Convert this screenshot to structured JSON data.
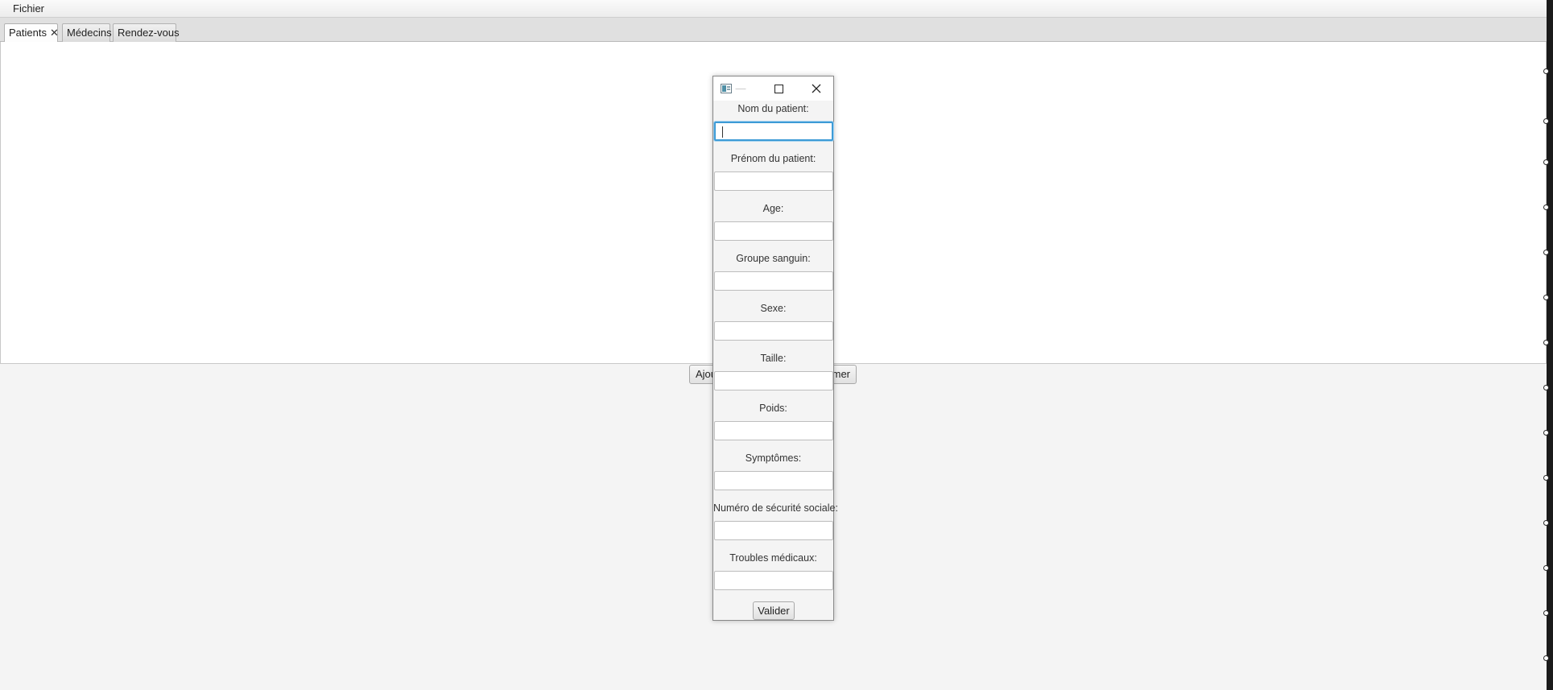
{
  "menubar": {
    "file_label": "Fichier"
  },
  "tabs": {
    "patients": "Patients",
    "patients_close": "✕",
    "medecins": "Médecins",
    "rendezvous": "Rendez-vous"
  },
  "buttons": {
    "ajouter": "Ajou",
    "supprimer": "mer"
  },
  "dialog": {
    "minimize_glyph": "—",
    "fields": {
      "nom": {
        "label": "Nom du patient:",
        "value": ""
      },
      "prenom": {
        "label": "Prénom du patient:",
        "value": ""
      },
      "age": {
        "label": "Age:",
        "value": ""
      },
      "groupe": {
        "label": "Groupe sanguin:",
        "value": ""
      },
      "sexe": {
        "label": "Sexe:",
        "value": ""
      },
      "taille": {
        "label": "Taille:",
        "value": ""
      },
      "poids": {
        "label": "Poids:",
        "value": ""
      },
      "symptomes": {
        "label": "Symptômes:",
        "value": ""
      },
      "secu": {
        "label": "Numéro de sécurité sociale:",
        "value": ""
      },
      "troubles": {
        "label": "Troubles médicaux:",
        "value": ""
      }
    },
    "submit_label": "Valider"
  },
  "colors": {
    "focus": "#3d9bd6",
    "window_bg": "#f4f4f4",
    "content_bg": "#ffffff"
  },
  "icons": {
    "dialog_app": "app-window-icon",
    "maximize": "maximize-icon",
    "close": "close-icon"
  }
}
